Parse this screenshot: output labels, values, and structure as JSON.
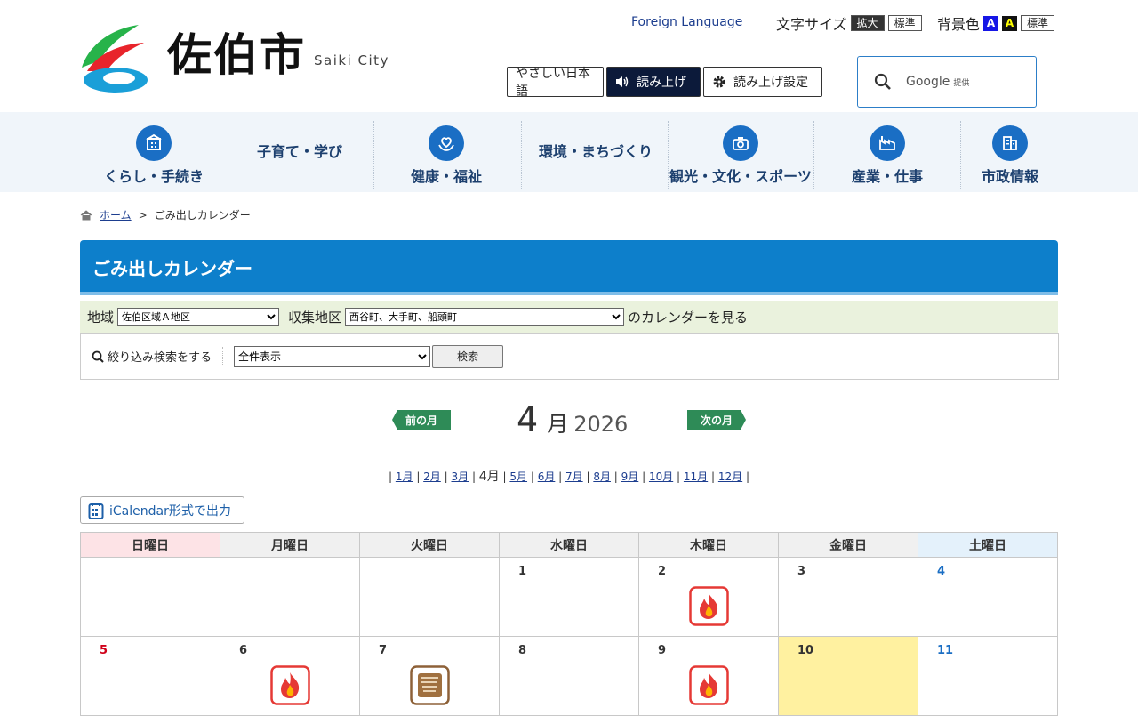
{
  "header": {
    "city_name": "佐伯市",
    "city_en": "Saiki  City",
    "foreign": "Foreign Language",
    "font_size_label": "文字サイズ",
    "font_size_large": "拡大",
    "font_size_normal": "標準",
    "bg_label": "背景色",
    "bg_blue": "A",
    "bg_black": "A",
    "bg_normal": "標準",
    "easy_japanese": "やさしい日本語",
    "read_aloud": "読み上げ",
    "read_settings": "読み上げ設定",
    "search_label": "Google",
    "search_sub": "提供"
  },
  "nav": {
    "items": [
      {
        "label": "くらし・手続き",
        "icon": "building-icon"
      },
      {
        "label": "子育て・学び",
        "icon": ""
      },
      {
        "label": "健康・福祉",
        "icon": "heart-hands-icon"
      },
      {
        "label": "環境・まちづくり",
        "icon": ""
      },
      {
        "label": "観光・文化・スポーツ",
        "icon": "camera-icon"
      },
      {
        "label": "産業・仕事",
        "icon": "factory-icon"
      },
      {
        "label": "市政情報",
        "icon": "city-hall-icon"
      }
    ]
  },
  "breadcrumb": {
    "home": "ホーム",
    "sep": ">",
    "current": "ごみ出しカレンダー"
  },
  "page_title": "ごみ出しカレンダー",
  "filter": {
    "region_label": "地域",
    "region_value": "佐伯区域Ａ地区",
    "district_label": "収集地区",
    "district_value": "西谷町、大手町、船頭町",
    "suffix": "のカレンダーを見る",
    "narrow_label": "絞り込み検索をする",
    "narrow_value": "全件表示",
    "search_button": "検索"
  },
  "month_nav": {
    "prev": "前の月",
    "next": "次の月",
    "month": "4",
    "month_unit": "月",
    "year": "2026"
  },
  "months": [
    "1月",
    "2月",
    "3月",
    "4月",
    "5月",
    "6月",
    "7月",
    "8月",
    "9月",
    "10月",
    "11月",
    "12月"
  ],
  "current_month": "4月",
  "ical": "iCalendar形式で出力",
  "calendar": {
    "weekdays": [
      "日曜日",
      "月曜日",
      "火曜日",
      "水曜日",
      "木曜日",
      "金曜日",
      "土曜日"
    ],
    "week1": [
      "",
      "",
      "",
      "1",
      "2",
      "3",
      "4"
    ],
    "week2": [
      "5",
      "6",
      "7",
      "8",
      "9",
      "10",
      "11"
    ],
    "icons": {
      "2": "burnable-garbage-icon",
      "6": "burnable-garbage-icon",
      "7": "non-burnable-garbage-icon",
      "9": "burnable-garbage-icon"
    },
    "today": "10"
  },
  "colors": {
    "accent_blue": "#0d7fcb",
    "nav_blue": "#1a6ec4",
    "green": "#2e8b57",
    "today": "#fff1a0"
  }
}
